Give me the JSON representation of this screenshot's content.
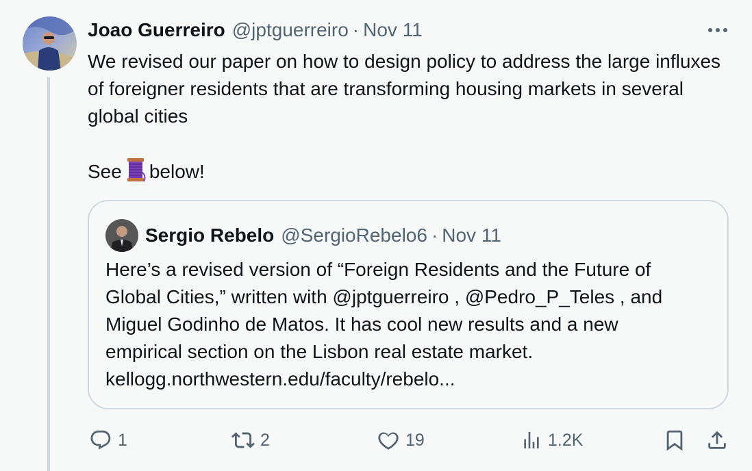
{
  "tweet": {
    "author_name": "Joao Guerreiro",
    "author_handle": "@jptguerreiro",
    "separator": "·",
    "date": "Nov 11",
    "text_paragraph_1": "We revised our paper on how to design policy to address the large influxes of foreigner residents that are transforming housing markets in several global cities",
    "text_see": "See",
    "text_emoji_icon": "spool-of-thread-icon",
    "text_below": "below!"
  },
  "quoted_tweet": {
    "author_name": "Sergio Rebelo",
    "author_handle": "@SergioRebelo6",
    "separator": "·",
    "date": "Nov 11",
    "line_1": "Here’s a revised version of “Foreign Residents and the Future of",
    "line_2": "Global Cities,” written with @jptguerreiro , @Pedro_P_Teles , and",
    "line_3": "Miguel Godinho de Matos. It has cool new results and a new",
    "line_4": "empirical section on the Lisbon real estate market.",
    "line_5": "kellogg.northwestern.edu/faculty/rebelo..."
  },
  "actions": {
    "reply_count": "1",
    "retweet_count": "2",
    "like_count": "19",
    "views_count": "1.2K"
  },
  "colors": {
    "background": "#f7f9f9",
    "text_primary": "#0f1419",
    "text_secondary": "#536471",
    "border": "#cfd9de"
  }
}
